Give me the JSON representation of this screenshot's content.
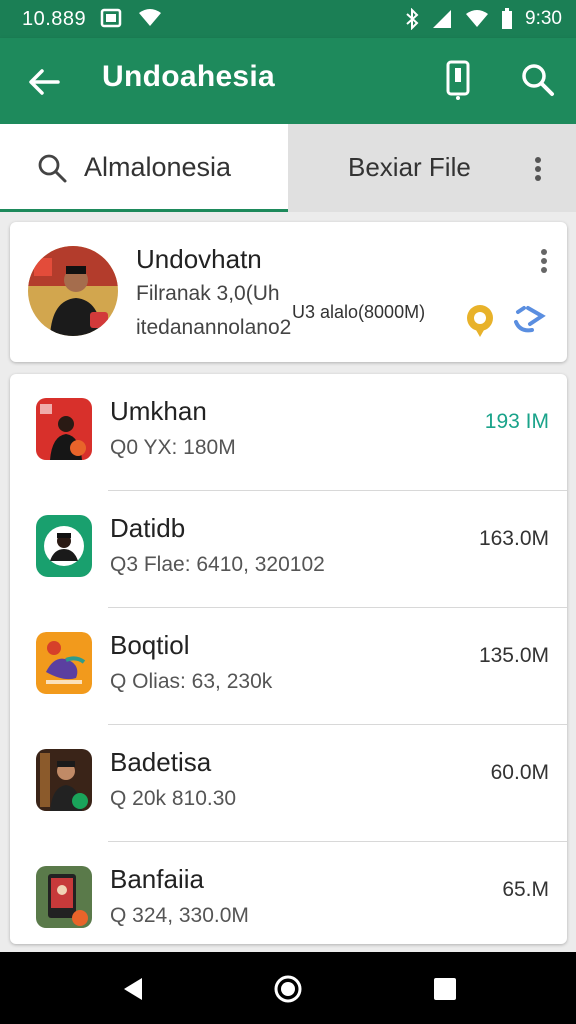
{
  "status": {
    "time": "10.889",
    "clock_right": "9:30"
  },
  "appbar": {
    "title": "Undoahesia",
    "back_icon": "arrow-back-icon",
    "action1_icon": "phone-notification-icon",
    "action2_icon": "search-icon"
  },
  "tabs": {
    "search_label": "Almalonesia",
    "file_label": "Bexiar File"
  },
  "featured": {
    "name": "Undovhatn",
    "line1": "Filranak 3,0(Uh",
    "line2": "itedanannolano2",
    "middle": "U3 alalo(8000M)"
  },
  "apps": [
    {
      "name": "Umkhan",
      "sub": "Q0 YX: 180M",
      "size": "193 IM",
      "accent": true
    },
    {
      "name": "Datidb",
      "sub": "Q3 Flae: 6410, 320102",
      "size": "163.0M",
      "accent": false
    },
    {
      "name": "Boqtiol",
      "sub": "Q Olias: 63, 230k",
      "size": "135.0M",
      "accent": false
    },
    {
      "name": "Badetisa",
      "sub": "Q 20k 810.30",
      "size": "60.0M",
      "accent": false
    },
    {
      "name": "Banfaiia",
      "sub": "Q 324, 330.0M",
      "size": "65.M",
      "accent": false
    }
  ],
  "colors": {
    "primary": "#1e8a5c",
    "statusbar": "#1b7f55",
    "accent_text": "#1aa38a"
  }
}
